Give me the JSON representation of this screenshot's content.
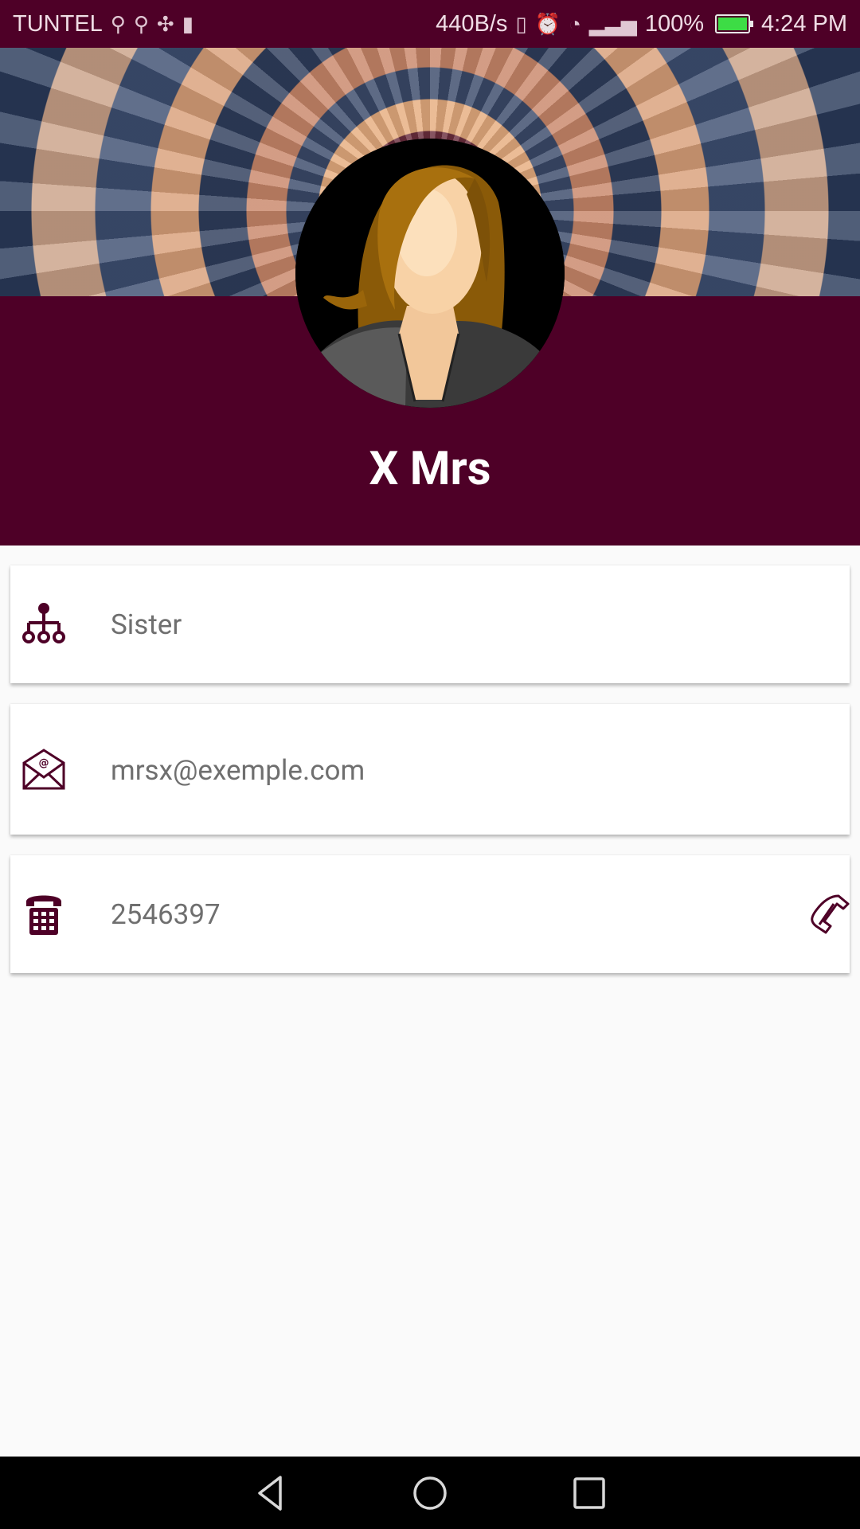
{
  "status_bar": {
    "carrier": "TUNTEL",
    "net_speed": "440B/s",
    "battery": "100%",
    "time": "4:24 PM"
  },
  "contact": {
    "name": "X Mrs",
    "relation": "Sister",
    "email": "mrsx@exemple.com",
    "phone": "2546397"
  },
  "colors": {
    "primary": "#4e0027",
    "value_text": "#6f6f6f",
    "background": "#fafafa"
  },
  "icons": {
    "relation": "hierarchy-icon",
    "email": "envelope-at-icon",
    "phone": "telephone-keypad-icon",
    "call": "handset-call-icon"
  }
}
